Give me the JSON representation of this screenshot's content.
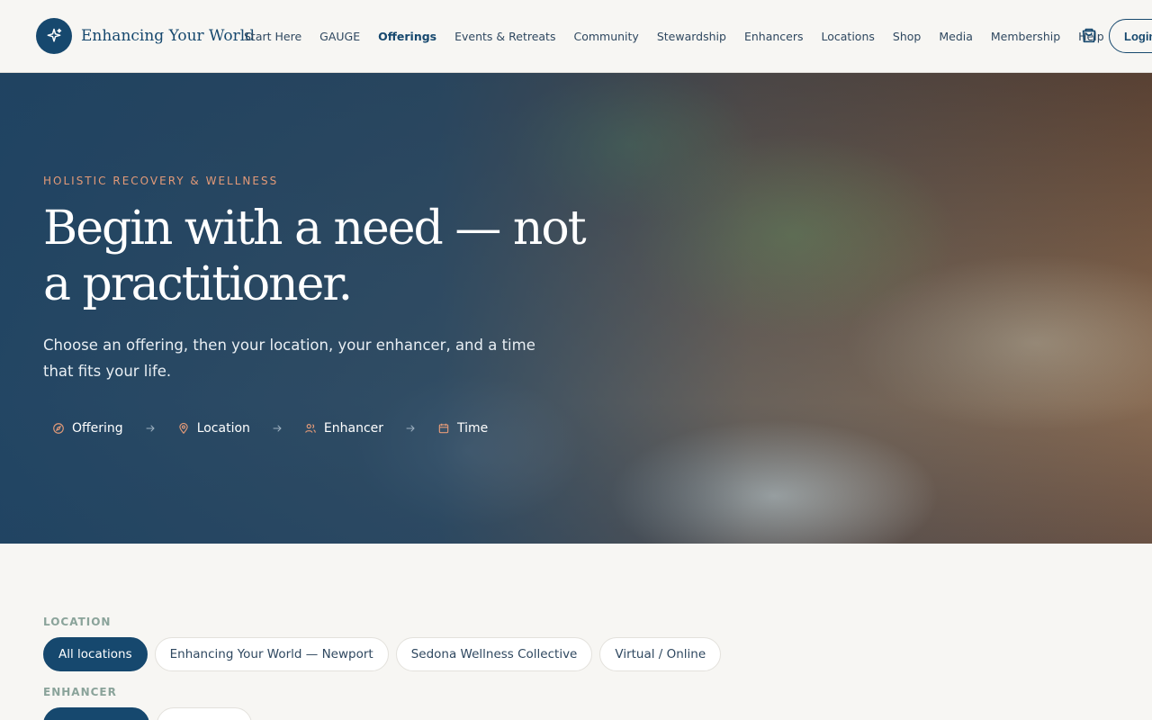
{
  "brand": {
    "name": "Enhancing Your World"
  },
  "nav": {
    "items": [
      {
        "label": "Start Here"
      },
      {
        "label": "GAUGE"
      },
      {
        "label": "Offerings",
        "active": true
      },
      {
        "label": "Events & Retreats"
      },
      {
        "label": "Community"
      },
      {
        "label": "Stewardship"
      },
      {
        "label": "Enhancers"
      },
      {
        "label": "Locations"
      },
      {
        "label": "Shop"
      },
      {
        "label": "Media"
      },
      {
        "label": "Membership"
      },
      {
        "label": "Help"
      }
    ],
    "cart_icon": "shopping-bag-icon",
    "login_label": "Login"
  },
  "hero": {
    "eyebrow": "HOLISTIC RECOVERY & WELLNESS",
    "title": "Begin with a need — not a practitioner.",
    "subtitle": "Choose an offering, then your location, your enhancer, and a time that fits your life.",
    "steps": [
      {
        "label": "Offering",
        "icon": "compass-icon"
      },
      {
        "label": "Location",
        "icon": "map-pin-icon"
      },
      {
        "label": "Enhancer",
        "icon": "users-icon"
      },
      {
        "label": "Time",
        "icon": "calendar-icon"
      }
    ]
  },
  "filters": {
    "location": {
      "label": "LOCATION",
      "options": [
        {
          "label": "All locations",
          "selected": true
        },
        {
          "label": "Enhancing Your World — Newport"
        },
        {
          "label": "Sedona Wellness Collective"
        },
        {
          "label": "Virtual / Online"
        }
      ]
    },
    "enhancer": {
      "label": "ENHANCER"
    }
  },
  "colors": {
    "primary": "#16486e",
    "accent": "#e39a78",
    "background": "#f7f6f3",
    "muted_label": "#8aa39a"
  }
}
